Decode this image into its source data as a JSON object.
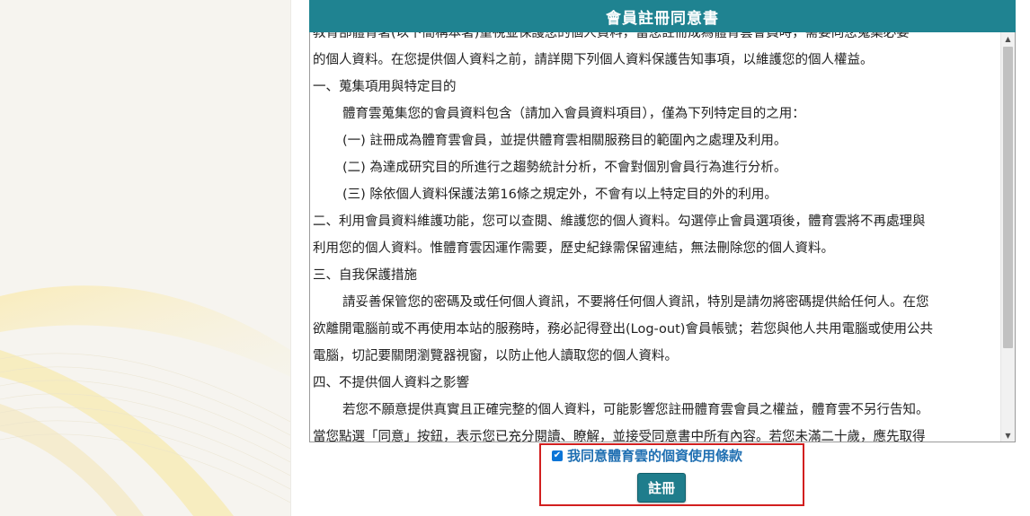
{
  "dialog": {
    "title": "會員註冊同意書"
  },
  "terms": {
    "lines": [
      {
        "text": "教育部體育署(以下簡稱本署)重視並保護您的個人資料，當您註冊成為體育雲會員時，需要向您蒐集必要",
        "indent": false
      },
      {
        "text": "的個人資料。在您提供個人資料之前，請詳閱下列個人資料保護告知事項，以維護您的個人權益。",
        "indent": false
      },
      {
        "text": "一、蒐集項用與特定目的",
        "indent": false
      },
      {
        "text": "體育雲蒐集您的會員資料包含（請加入會員資料項目），僅為下列特定目的之用：",
        "indent": true
      },
      {
        "text": "(一) 註冊成為體育雲會員，並提供體育雲相關服務目的範圍內之處理及利用。",
        "indent": true
      },
      {
        "text": "(二) 為達成研究目的所進行之趨勢統計分析，不會對個別會員行為進行分析。",
        "indent": true
      },
      {
        "text": "(三) 除依個人資料保護法第16條之規定外，不會有以上特定目的外的利用。",
        "indent": true
      },
      {
        "text": "二、利用會員資料維護功能，您可以查閱、維護您的個人資料。勾選停止會員選項後，體育雲將不再處理與",
        "indent": false
      },
      {
        "text": "利用您的個人資料。惟體育雲因運作需要，歷史紀錄需保留連結，無法刪除您的個人資料。",
        "indent": false
      },
      {
        "text": "三、自我保護措施",
        "indent": false
      },
      {
        "text": "請妥善保管您的密碼及或任何個人資訊，不要將任何個人資訊，特別是請勿將密碼提供給任何人。在您",
        "indent": true
      },
      {
        "text": "欲離開電腦前或不再使用本站的服務時，務必記得登出(Log-out)會員帳號；若您與他人共用電腦或使用公共",
        "indent": false
      },
      {
        "text": "電腦，切記要關閉瀏覽器視窗，以防止他人讀取您的個人資料。",
        "indent": false
      },
      {
        "text": "四、不提供個人資料之影響",
        "indent": false
      },
      {
        "text": "若您不願意提供真實且正確完整的個人資料，可能影響您註冊體育雲會員之權益，體育雲不另行告知。",
        "indent": true
      },
      {
        "text": "當您點選「同意」按鈕，表示您已充分閱讀、瞭解，並接受同意書中所有內容。若您未滿二十歲，應先取得",
        "indent": false
      }
    ],
    "scroll_position_fraction": 0.0
  },
  "agreement": {
    "checked": true,
    "label": "我同意體育雲的個資使用條款"
  },
  "register_button": {
    "label": "註冊"
  },
  "icons": {
    "checkbox": "checkmark-icon",
    "scroll_up": "triangle-up-icon",
    "scroll_down": "triangle-down-icon"
  },
  "colors": {
    "header_bg": "#1f8391",
    "button_bg": "#1f7d8c",
    "agree_text": "#1f6fb2",
    "highlight": "#d21f1f"
  }
}
